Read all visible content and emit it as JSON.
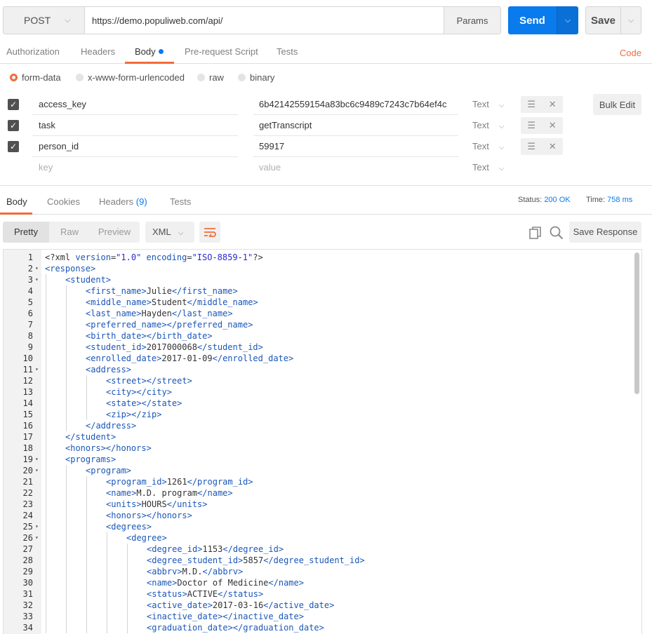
{
  "request": {
    "method": "POST",
    "url": "https://demo.populiweb.com/api/",
    "params_label": "Params",
    "send_label": "Send",
    "save_label": "Save"
  },
  "request_tabs": [
    "Authorization",
    "Headers",
    "Body",
    "Pre-request Script",
    "Tests"
  ],
  "active_request_tab": "Body",
  "code_link": "Code",
  "body_types": [
    {
      "label": "form-data",
      "selected": true
    },
    {
      "label": "x-www-form-urlencoded",
      "selected": false
    },
    {
      "label": "raw",
      "selected": false
    },
    {
      "label": "binary",
      "selected": false
    }
  ],
  "form_rows": [
    {
      "key": "access_key",
      "value": "6b42142559154a83bc6c9489c7243c7b64ef4c",
      "type": "Text",
      "checked": true
    },
    {
      "key": "task",
      "value": "getTranscript",
      "type": "Text",
      "checked": true
    },
    {
      "key": "person_id",
      "value": "59917",
      "type": "Text",
      "checked": true
    }
  ],
  "form_placeholder": {
    "key": "key",
    "value": "value",
    "type": "Text"
  },
  "bulk_edit_label": "Bulk Edit",
  "response_tabs": {
    "body": "Body",
    "cookies": "Cookies",
    "headers": "Headers",
    "headers_count": "(9)",
    "tests": "Tests"
  },
  "status": {
    "label": "Status:",
    "value": "200 OK"
  },
  "time": {
    "label": "Time:",
    "value": "758 ms"
  },
  "view_modes": [
    "Pretty",
    "Raw",
    "Preview"
  ],
  "active_view_mode": "Pretty",
  "format": "XML",
  "save_response_label": "Save Response",
  "code_lines": [
    {
      "n": 1,
      "indent": 0,
      "fold": false,
      "text": "<?xml version=\"1.0\" encoding=\"ISO-8859-1\"?>"
    },
    {
      "n": 2,
      "indent": 0,
      "fold": true,
      "text": "<response>"
    },
    {
      "n": 3,
      "indent": 1,
      "fold": true,
      "text": "<student>"
    },
    {
      "n": 4,
      "indent": 2,
      "fold": false,
      "text": "<first_name>Julie</first_name>"
    },
    {
      "n": 5,
      "indent": 2,
      "fold": false,
      "text": "<middle_name>Student</middle_name>"
    },
    {
      "n": 6,
      "indent": 2,
      "fold": false,
      "text": "<last_name>Hayden</last_name>"
    },
    {
      "n": 7,
      "indent": 2,
      "fold": false,
      "text": "<preferred_name></preferred_name>"
    },
    {
      "n": 8,
      "indent": 2,
      "fold": false,
      "text": "<birth_date></birth_date>"
    },
    {
      "n": 9,
      "indent": 2,
      "fold": false,
      "text": "<student_id>2017000068</student_id>"
    },
    {
      "n": 10,
      "indent": 2,
      "fold": false,
      "text": "<enrolled_date>2017-01-09</enrolled_date>"
    },
    {
      "n": 11,
      "indent": 2,
      "fold": true,
      "text": "<address>"
    },
    {
      "n": 12,
      "indent": 3,
      "fold": false,
      "text": "<street></street>"
    },
    {
      "n": 13,
      "indent": 3,
      "fold": false,
      "text": "<city></city>"
    },
    {
      "n": 14,
      "indent": 3,
      "fold": false,
      "text": "<state></state>"
    },
    {
      "n": 15,
      "indent": 3,
      "fold": false,
      "text": "<zip></zip>"
    },
    {
      "n": 16,
      "indent": 2,
      "fold": false,
      "text": "</address>"
    },
    {
      "n": 17,
      "indent": 1,
      "fold": false,
      "text": "</student>"
    },
    {
      "n": 18,
      "indent": 1,
      "fold": false,
      "text": "<honors></honors>"
    },
    {
      "n": 19,
      "indent": 1,
      "fold": true,
      "text": "<programs>"
    },
    {
      "n": 20,
      "indent": 2,
      "fold": true,
      "text": "<program>"
    },
    {
      "n": 21,
      "indent": 3,
      "fold": false,
      "text": "<program_id>1261</program_id>"
    },
    {
      "n": 22,
      "indent": 3,
      "fold": false,
      "text": "<name>M.D. program</name>"
    },
    {
      "n": 23,
      "indent": 3,
      "fold": false,
      "text": "<units>HOURS</units>"
    },
    {
      "n": 24,
      "indent": 3,
      "fold": false,
      "text": "<honors></honors>"
    },
    {
      "n": 25,
      "indent": 3,
      "fold": true,
      "text": "<degrees>"
    },
    {
      "n": 26,
      "indent": 4,
      "fold": true,
      "text": "<degree>"
    },
    {
      "n": 27,
      "indent": 5,
      "fold": false,
      "text": "<degree_id>1153</degree_id>"
    },
    {
      "n": 28,
      "indent": 5,
      "fold": false,
      "text": "<degree_student_id>5857</degree_student_id>"
    },
    {
      "n": 29,
      "indent": 5,
      "fold": false,
      "text": "<abbrv>M.D.</abbrv>"
    },
    {
      "n": 30,
      "indent": 5,
      "fold": false,
      "text": "<name>Doctor of Medicine</name>"
    },
    {
      "n": 31,
      "indent": 5,
      "fold": false,
      "text": "<status>ACTIVE</status>"
    },
    {
      "n": 32,
      "indent": 5,
      "fold": false,
      "text": "<active_date>2017-03-16</active_date>"
    },
    {
      "n": 33,
      "indent": 5,
      "fold": false,
      "text": "<inactive_date></inactive_date>"
    },
    {
      "n": 34,
      "indent": 5,
      "fold": false,
      "text": "<graduation_date></graduation_date>"
    }
  ],
  "colors": {
    "accent": "#f26b3a",
    "send": "#097bed",
    "tag": "#1a56b8"
  }
}
